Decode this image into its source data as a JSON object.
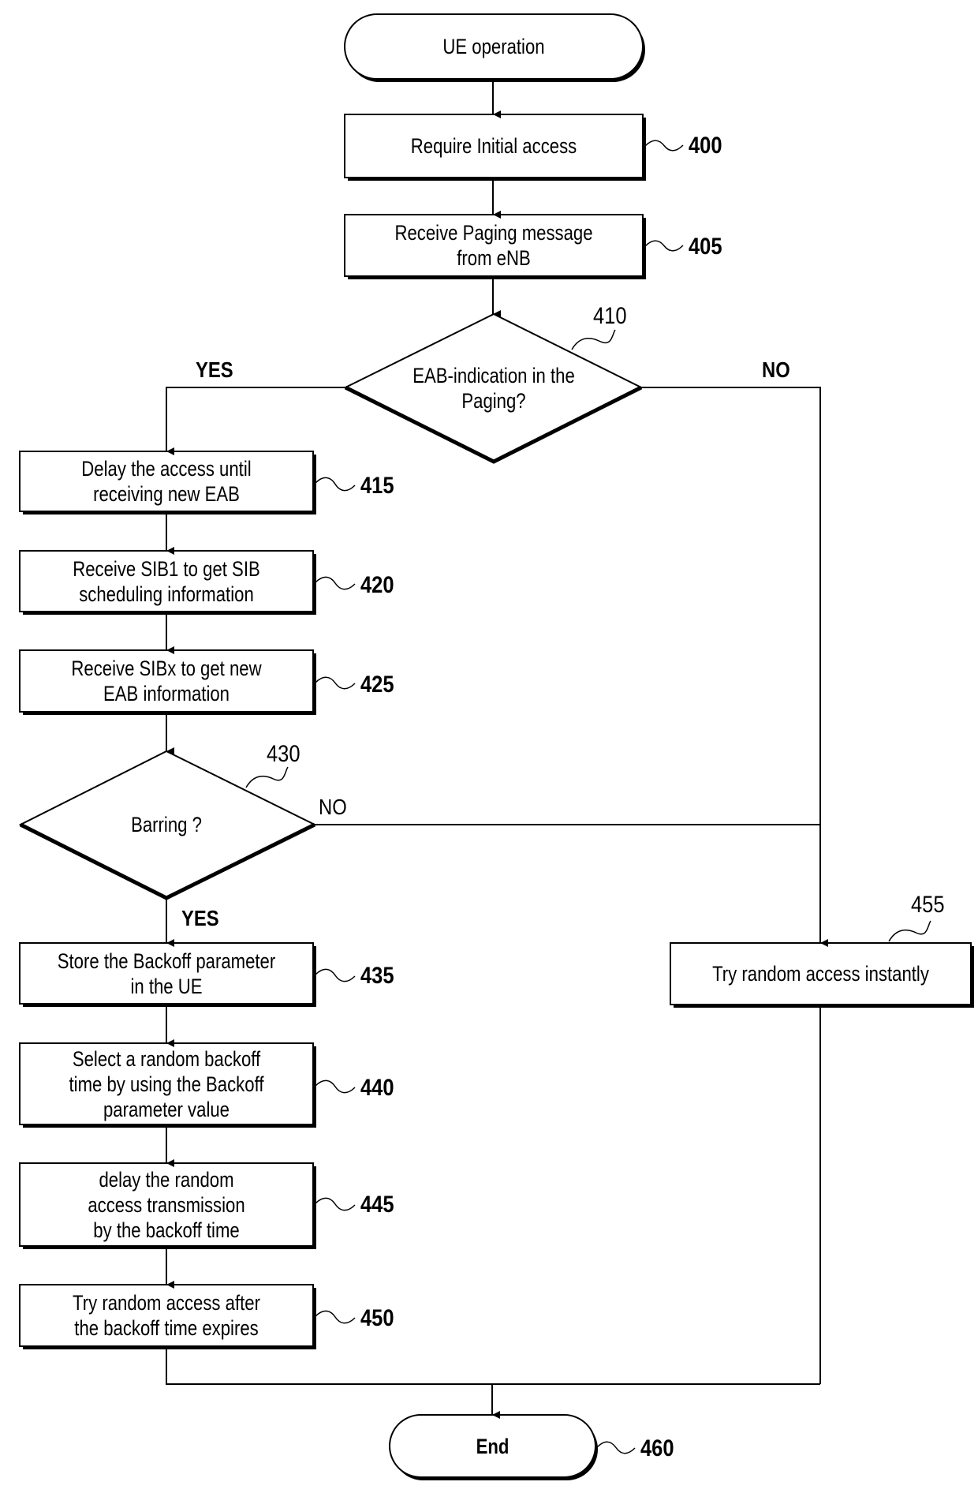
{
  "diagram": {
    "type": "flowchart",
    "nodes": {
      "start": {
        "shape": "terminator",
        "label": "UE operation"
      },
      "n400": {
        "shape": "process",
        "label": "Require Initial access",
        "ref": "400"
      },
      "n405": {
        "shape": "process",
        "label": "Receive Paging message\nfrom eNB",
        "ref": "405"
      },
      "n410": {
        "shape": "decision",
        "label": "EAB-indication in the\nPaging?",
        "ref": "410"
      },
      "n415": {
        "shape": "process",
        "label": "Delay the access until\nreceiving new EAB",
        "ref": "415"
      },
      "n420": {
        "shape": "process",
        "label": "Receive SIB1 to get SIB\nscheduling information",
        "ref": "420"
      },
      "n425": {
        "shape": "process",
        "label": "Receive SIBx to get new\nEAB information",
        "ref": "425"
      },
      "n430": {
        "shape": "decision",
        "label": "Barring ?",
        "ref": "430"
      },
      "n435": {
        "shape": "process",
        "label": "Store the Backoff parameter\nin the UE",
        "ref": "435"
      },
      "n440": {
        "shape": "process",
        "label": "Select a random backoff\ntime by using the Backoff\nparameter value",
        "ref": "440"
      },
      "n445": {
        "shape": "process",
        "label": "delay the random\naccess transmission\nby the backoff time",
        "ref": "445"
      },
      "n450": {
        "shape": "process",
        "label": "Try random access after\nthe backoff time expires",
        "ref": "450"
      },
      "n455": {
        "shape": "process",
        "label": "Try random access instantly",
        "ref": "455"
      },
      "end": {
        "shape": "terminator",
        "label": "End",
        "ref": "460"
      }
    },
    "branch_labels": {
      "n410_yes": "YES",
      "n410_no": "NO",
      "n430_no": "NO",
      "n430_yes": "YES"
    },
    "edges": [
      [
        "start",
        "n400"
      ],
      [
        "n400",
        "n405"
      ],
      [
        "n405",
        "n410"
      ],
      [
        "n410",
        "n415",
        "YES"
      ],
      [
        "n410",
        "n455",
        "NO"
      ],
      [
        "n415",
        "n420"
      ],
      [
        "n420",
        "n425"
      ],
      [
        "n425",
        "n430"
      ],
      [
        "n430",
        "n435",
        "YES"
      ],
      [
        "n430",
        "n455",
        "NO"
      ],
      [
        "n435",
        "n440"
      ],
      [
        "n440",
        "n445"
      ],
      [
        "n445",
        "n450"
      ],
      [
        "n450",
        "end"
      ],
      [
        "n455",
        "end"
      ]
    ]
  }
}
